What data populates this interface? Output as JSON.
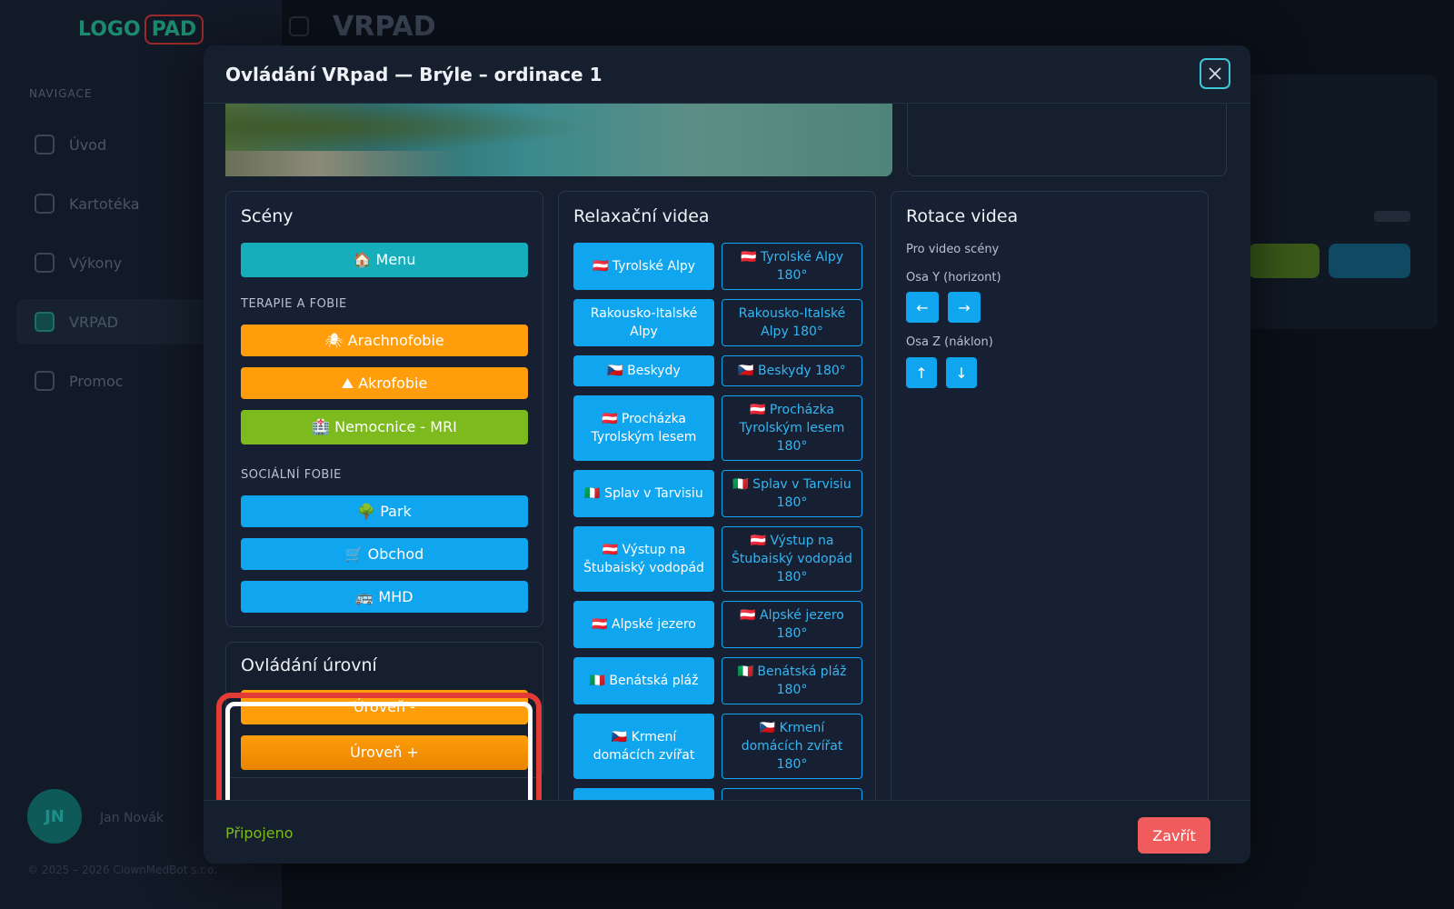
{
  "background": {
    "logo_a": "LOGO",
    "logo_b": "PAD",
    "section": "NAVIGACE",
    "nav": [
      "Úvod",
      "Kartotéka",
      "Výkony",
      "VRPAD",
      "Promoc"
    ],
    "page_title": "VRPAD",
    "user_initials": "JN",
    "user_name": "Jan Novák",
    "footer": "© 2025 – 2026 ClownMedBot s.r.o."
  },
  "modal": {
    "title": "Ovládání VRpad — Brýle – ordinace 1",
    "close_icon": "close-icon"
  },
  "scenes": {
    "title": "Scény",
    "menu": "🏠 Menu",
    "therapy_label": "TERAPIE A FOBIE",
    "therapy": [
      "🕷 Arachnofobie",
      "⛰ Akrofobie",
      "🏥 Nemocnice - MRI"
    ],
    "social_label": "SOCIÁLNÍ FOBIE",
    "social": [
      "🌳 Park",
      "🛒 Obchod",
      "🚌 MHD"
    ]
  },
  "levels": {
    "title": "Ovládání úrovní",
    "down": "Úroveň -",
    "up": "Úroveň +"
  },
  "videos": {
    "title": "Relaxační videa",
    "rows": [
      [
        "🇦🇹 Tyrolské Alpy",
        "🇦🇹 Tyrolské Alpy 180°"
      ],
      [
        "Rakousko-Italské Alpy",
        "Rakousko-Italské Alpy 180°"
      ],
      [
        "🇨🇿 Beskydy",
        "🇨🇿 Beskydy 180°"
      ],
      [
        "🇦🇹 Procházka Tyrolským lesem",
        "🇦🇹 Procházka Tyrolským lesem 180°"
      ],
      [
        "🇮🇹 Splav v Tarvisiu",
        "🇮🇹 Splav v Tarvisiu 180°"
      ],
      [
        "🇦🇹 Výstup na Štubaiský vodopád",
        "🇦🇹 Výstup na Štubaiský vodopád 180°"
      ],
      [
        "🇦🇹 Alpské jezero",
        "🇦🇹 Alpské jezero 180°"
      ],
      [
        "🇮🇹 Benátská pláž",
        "🇮🇹 Benátská pláž 180°"
      ],
      [
        "🇨🇿 Krmení domácích zvířat",
        "🇨🇿 Krmení domácích zvířat 180°"
      ]
    ]
  },
  "rotation": {
    "title": "Rotace videa",
    "for_label": "Pro video scény",
    "y_label": "Osa Y (horizont)",
    "z_label": "Osa Z (náklon)",
    "left": "←",
    "right": "→",
    "up": "↑",
    "down": "↓"
  },
  "footer": {
    "status": "Připojeno",
    "close": "Zavřít"
  },
  "colors": {
    "accent_blue": "#10a5ef",
    "teal": "#17aebc",
    "orange": "#ff9d0a",
    "green": "#7cba1e",
    "danger": "#f05c5c",
    "highlight_red": "#e33b36"
  }
}
